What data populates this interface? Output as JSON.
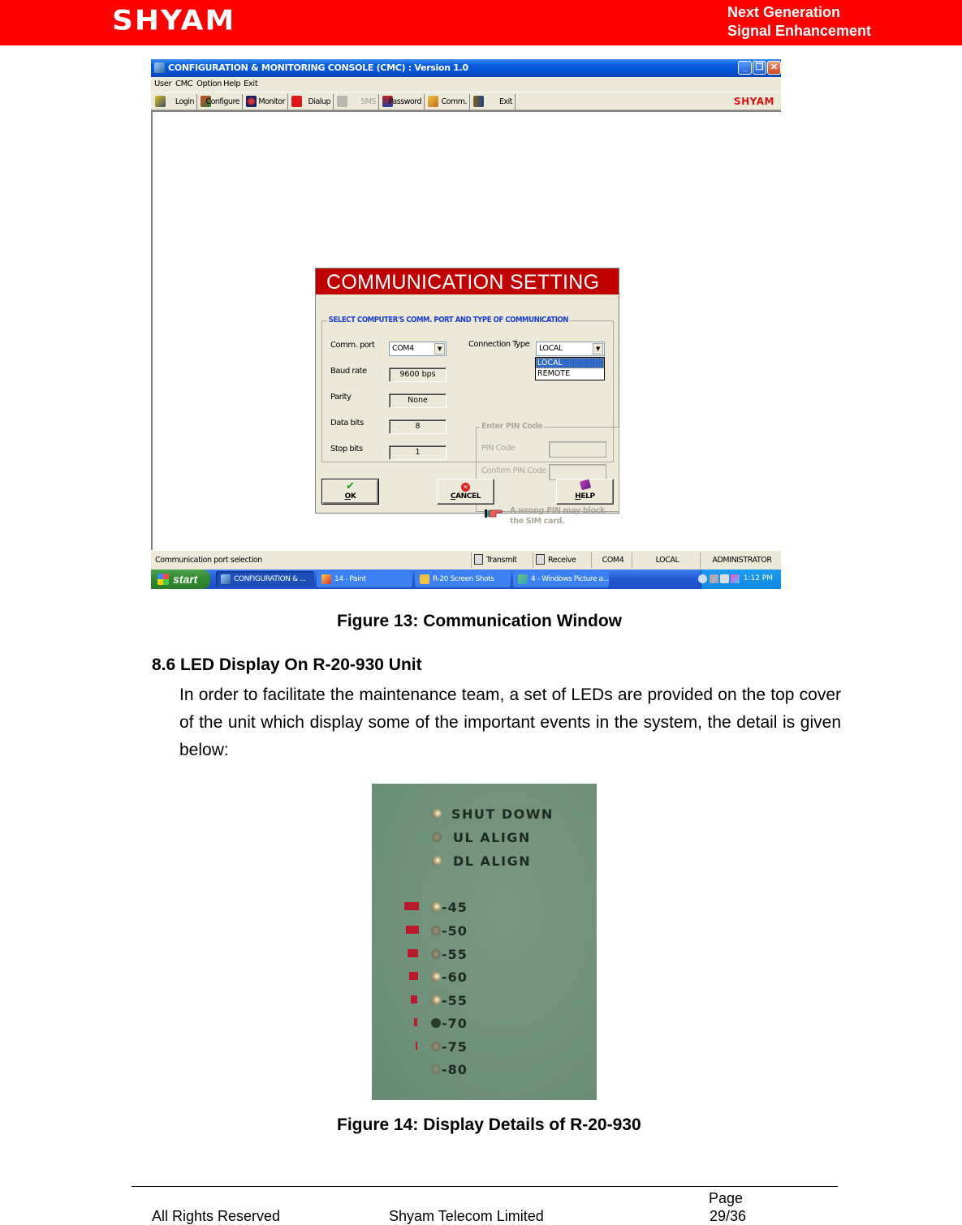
{
  "header": {
    "brand": "SHYAM",
    "tagline_line1": "Next Generation",
    "tagline_line2": "Signal Enhancement",
    "brand_color": "#ff0000"
  },
  "figure13": {
    "window": {
      "title": "CONFIGURATION & MONITORING CONSOLE (CMC)  :  Version 1.0",
      "controls": {
        "minimize": "_",
        "restore": "❐",
        "close": "✕"
      },
      "menu": [
        "User",
        "CMC",
        "Option",
        "Help",
        "Exit"
      ],
      "toolbar": [
        {
          "label": "Login",
          "icon": "key-user-icon",
          "enabled": true
        },
        {
          "label": "Configure",
          "icon": "configure-icon",
          "enabled": true
        },
        {
          "label": "Monitor",
          "icon": "monitor-icon",
          "enabled": true
        },
        {
          "label": "Dialup",
          "icon": "telephone-icon",
          "enabled": true
        },
        {
          "label": "SMS",
          "icon": "sms-icon",
          "enabled": false
        },
        {
          "label": "Password",
          "icon": "padlock-icon",
          "enabled": true
        },
        {
          "label": "Comm.",
          "icon": "plug-icon",
          "enabled": true
        },
        {
          "label": "Exit",
          "icon": "exit-door-icon",
          "enabled": true
        }
      ],
      "toolbar_logo": "SHYAM"
    },
    "dialog": {
      "title": "COMMUNICATION SETTING",
      "group_title": "SELECT COMPUTER'S COMM. PORT AND TYPE OF COMMUNICATION",
      "fields": {
        "comm_port": {
          "label": "Comm. port",
          "value": "COM4"
        },
        "baud_rate": {
          "label": "Baud rate",
          "value": "9600 bps"
        },
        "parity": {
          "label": "Parity",
          "value": "None"
        },
        "data_bits": {
          "label": "Data bits",
          "value": "8"
        },
        "stop_bits": {
          "label": "Stop bits",
          "value": "1"
        },
        "connection_type": {
          "label": "Connection Type",
          "value": "LOCAL",
          "options": [
            "LOCAL",
            "REMOTE"
          ],
          "highlighted": "LOCAL"
        }
      },
      "pin_group": {
        "title": "Enter PIN Code",
        "pin_label": "PIN Code",
        "pin_value": "",
        "confirm_label": "Confirm PIN Code",
        "confirm_value": "",
        "warning": "A wrong PIN may block the SIM card."
      },
      "buttons": {
        "ok": "OK",
        "cancel": "CANCEL",
        "help": "HELP"
      },
      "title_color": "#c00000"
    },
    "statusbar": {
      "message": "Communication port selection",
      "transmit": "Transmit",
      "receive": "Receive",
      "port": "COM4",
      "mode": "LOCAL",
      "user": "ADMINISTRATOR"
    },
    "taskbar": {
      "start": "start",
      "tasks": [
        {
          "label": "CONFIGURATION & ...",
          "active": true
        },
        {
          "label": "14 - Paint",
          "active": false
        },
        {
          "label": "R-20 Screen Shots",
          "active": false
        },
        {
          "label": "4 - Windows Picture a...",
          "active": false
        }
      ],
      "clock": "1:12 PM"
    },
    "caption": "Figure 13: Communication Window"
  },
  "section": {
    "heading": "8.6 LED Display On R-20-930 Unit",
    "paragraph": "In order to facilitate the maintenance team, a set of LEDs are provided on the top cover of the unit which display some of the important events in the system, the detail is given below:"
  },
  "figure14": {
    "status_leds": [
      "SHUT DOWN",
      "UL ALIGN",
      "DL ALIGN"
    ],
    "level_leds": [
      "-45",
      "-50",
      "-55",
      "-60",
      "-55",
      "-70",
      "-75",
      "-80"
    ],
    "caption": "Figure 14: Display Details of R-20-930"
  },
  "footer": {
    "rights": "All Rights Reserved",
    "company": "Shyam Telecom Limited",
    "page_label": "Page",
    "page_number": "29/36"
  }
}
